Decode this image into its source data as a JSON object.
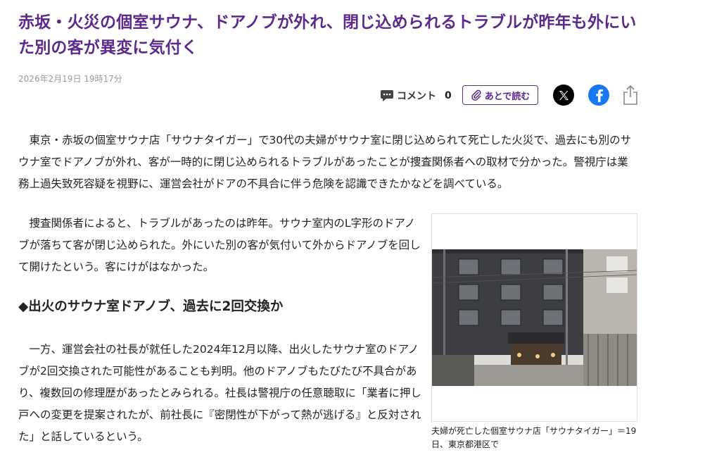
{
  "article": {
    "title": "赤坂・火災の個室サウナ、ドアノブが外れ、閉じ込められるトラブルが昨年も外にいた別の客が異変に気付く",
    "date": "2026年2月19日 19時17分",
    "paragraph1": "東京・赤坂の個室サウナ店「サウナタイガー」で30代の夫婦がサウナ室に閉じ込められて死亡した火災で、過去にも別のサウナ室でドアノブが外れ、客が一時的に閉じ込められるトラブルがあったことが捜査関係者への取材で分かった。警視庁は業務上過失致死容疑を視野に、運営会社がドアの不具合に伴う危険を認識できたかなどを調べている。",
    "paragraph2": "捜査関係者によると、トラブルがあったのは昨年。サウナ室内のL字形のドアノブが落ちて客が閉じ込められた。外にいた別の客が気付いて外からドアノブを回して開けたという。客にけがはなかった。",
    "subheading": "◆出火のサウナ室ドアノブ、過去に2回交換か",
    "paragraph3": "一方、運営会社の社長が就任した2024年12月以降、出火したサウナ室のドアノブが2回交換された可能性があることも判明。他のドアノブもたびたび不具合があり、複数回の修理歴があったとみられる。社長は警視庁の任意聴取に「業者に押し戸への変更を提案されたが、前社長に『密閉性が下がって熱が逃げる』と反対された」と話しているという。"
  },
  "toolbar": {
    "comment_label": "コメント",
    "comment_count": "0",
    "read_later_label": "あとで読む",
    "icons": [
      "comment-icon",
      "paperclip-icon",
      "x-logo-icon",
      "facebook-logo-icon",
      "share-icon"
    ]
  },
  "figure": {
    "caption": "夫婦が死亡した個室サウナ店「サウナタイガー」＝19日、東京都港区で"
  },
  "colors": {
    "title": "#5b2a8a",
    "accent_border": "#5b2a8a",
    "facebook": "#1877f2",
    "x": "#000000"
  }
}
